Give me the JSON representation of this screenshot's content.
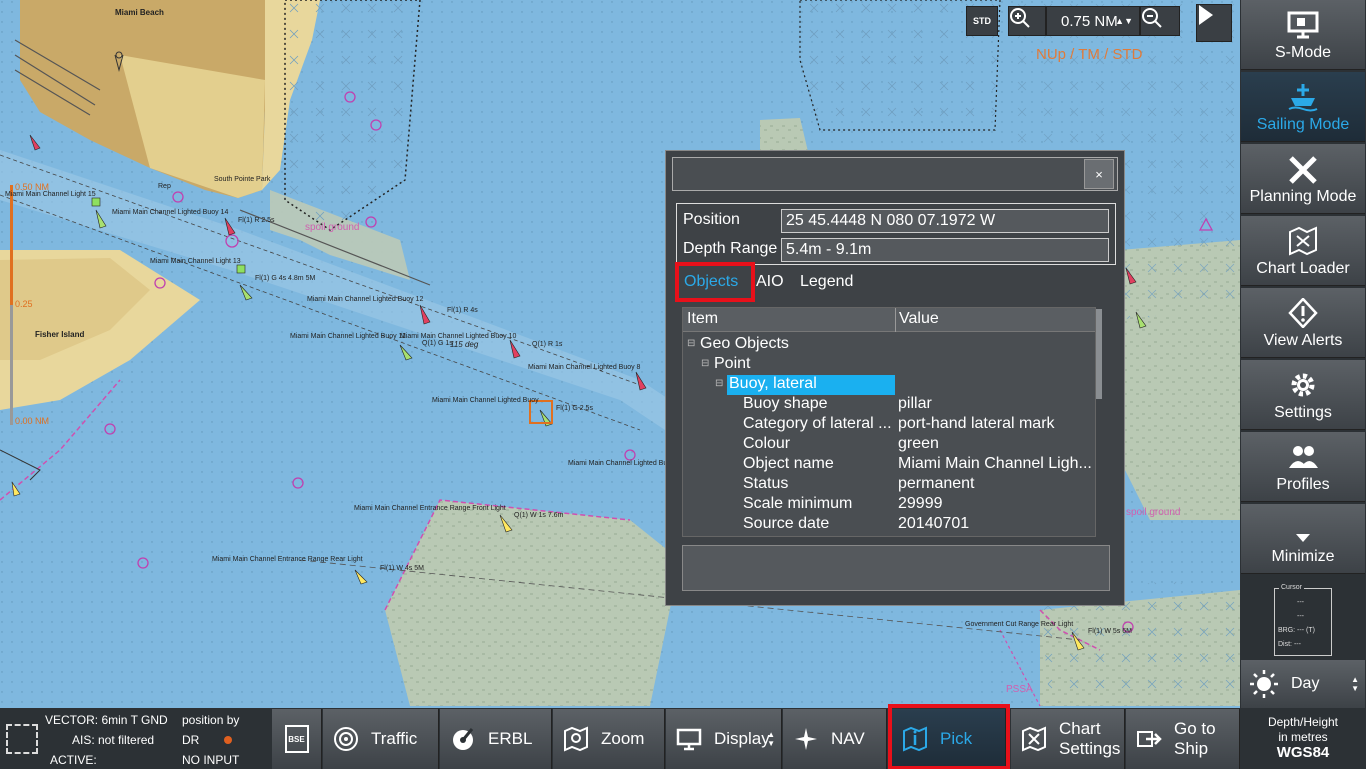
{
  "map": {
    "labels": {
      "miami_beach": "Miami Beach",
      "fisher_island": "Fisher Island",
      "south_pointe_park": "South Pointe Park",
      "spoil_ground_1": "spoil ground",
      "spoil_ground_2": "spoil ground",
      "buoy_14": "Miami Main Channel Lighted Buoy 14",
      "light_15": "Miami Main Channel Light 15",
      "light_13": "Miami Main Channel Light 13",
      "buoy_12": "Miami Main Channel Lighted Buoy 12",
      "buoy_11": "Miami Main Channel Lighted Buoy 11",
      "buoy_10": "Miami Main Channel Lighted Buoy 10",
      "buoy_8": "Miami Main Channel Lighted Buoy 8",
      "buoy_9": "Miami Main Channel Lighted Buoy",
      "buoy_7": "Miami Main Channel Lighted Buoy",
      "range_front": "Miami Main Channel Entrance Range Front Light",
      "range_rear": "Miami Main Channel Entrance Range Rear Light",
      "gov_cut": "Government Cut Range Rear Light",
      "fl_r4s": "Fl(1) R 4s",
      "fl_g4s": "Fl(1) G 4s 4.8m 5M",
      "fl_r2_5s": "Fl(1) R 2.5s",
      "q_r1s": "Q(1) R 1s",
      "q_g1s": "Q(1) G 1s",
      "fl_g2_5s": "Fl(1) G 2.5s",
      "q_w1s": "Q(1) W 1s 7.6m",
      "fl_w4s": "Fl(1) W 4s 5M",
      "fl_w5s": "Fl(1) W 5s 6M",
      "deg_label": "115 deg",
      "rep": "Rep",
      "pssa": "PSSA",
      "scale_050": "0.50 NM",
      "scale_025": "0.25",
      "scale_000": "0.00 NM"
    }
  },
  "controls": {
    "std_badge": "STD",
    "zoom_value": "0.75 NM",
    "orientation": "NUp / TM / STD"
  },
  "sidebar": {
    "items": [
      {
        "label": "S-Mode",
        "icon": "monitor-icon",
        "active": false
      },
      {
        "label": "Sailing Mode",
        "icon": "ship-icon",
        "active": true
      },
      {
        "label": "Planning Mode",
        "icon": "pencil-ruler-icon",
        "active": false
      },
      {
        "label": "Chart Loader",
        "icon": "map-loader-icon",
        "active": false
      },
      {
        "label": "View Alerts",
        "icon": "alert-diamond-icon",
        "active": false
      },
      {
        "label": "Settings",
        "icon": "gear-icon",
        "active": false
      },
      {
        "label": "Profiles",
        "icon": "people-icon",
        "active": false
      },
      {
        "label": "Minimize",
        "icon": "triangle-down-icon",
        "active": false
      }
    ],
    "cursor": {
      "title": "Cursor",
      "line1": "---",
      "line2": "---",
      "brg": "BRG:  ---  (T)",
      "dist": "Dist:  ---"
    },
    "day_mode": "Day",
    "depth_label": "Depth/Height",
    "depth_units": "in metres",
    "datum": "WGS84"
  },
  "status": {
    "vector": "VECTOR: 6min T GND",
    "ais": "AIS: not filtered",
    "active": "ACTIVE:",
    "position_by": "position by",
    "dr": "DR",
    "no_input": "NO INPUT"
  },
  "bottombar": {
    "bse": "BSE",
    "traffic": "Traffic",
    "erbl": "ERBL",
    "zoom": "Zoom",
    "display": "Display",
    "nav": "NAV",
    "pick": "Pick",
    "chart_settings_1": "Chart",
    "chart_settings_2": "Settings",
    "goto_ship_1": "Go to",
    "goto_ship_2": "Ship"
  },
  "dialog": {
    "close": "×",
    "position_label": "Position",
    "position_value": "25 45.4448 N  080 07.1972 W",
    "depth_label": "Depth Range",
    "depth_value": "5.4m - 9.1m",
    "tabs": [
      "Objects",
      "AIO",
      "Legend"
    ],
    "columns": [
      "Item",
      "Value"
    ],
    "tree": {
      "geo_objects": "Geo Objects",
      "point": "Point",
      "selected": "Buoy, lateral",
      "rows": [
        {
          "key": "Buoy shape",
          "value": "pillar"
        },
        {
          "key": "Category of lateral ...",
          "value": "port-hand lateral mark"
        },
        {
          "key": "Colour",
          "value": "green"
        },
        {
          "key": "Object name",
          "value": "Miami Main Channel Ligh..."
        },
        {
          "key": "Status",
          "value": "permanent"
        },
        {
          "key": "Scale minimum",
          "value": "29999"
        },
        {
          "key": "Source date",
          "value": "20140701"
        }
      ]
    }
  }
}
